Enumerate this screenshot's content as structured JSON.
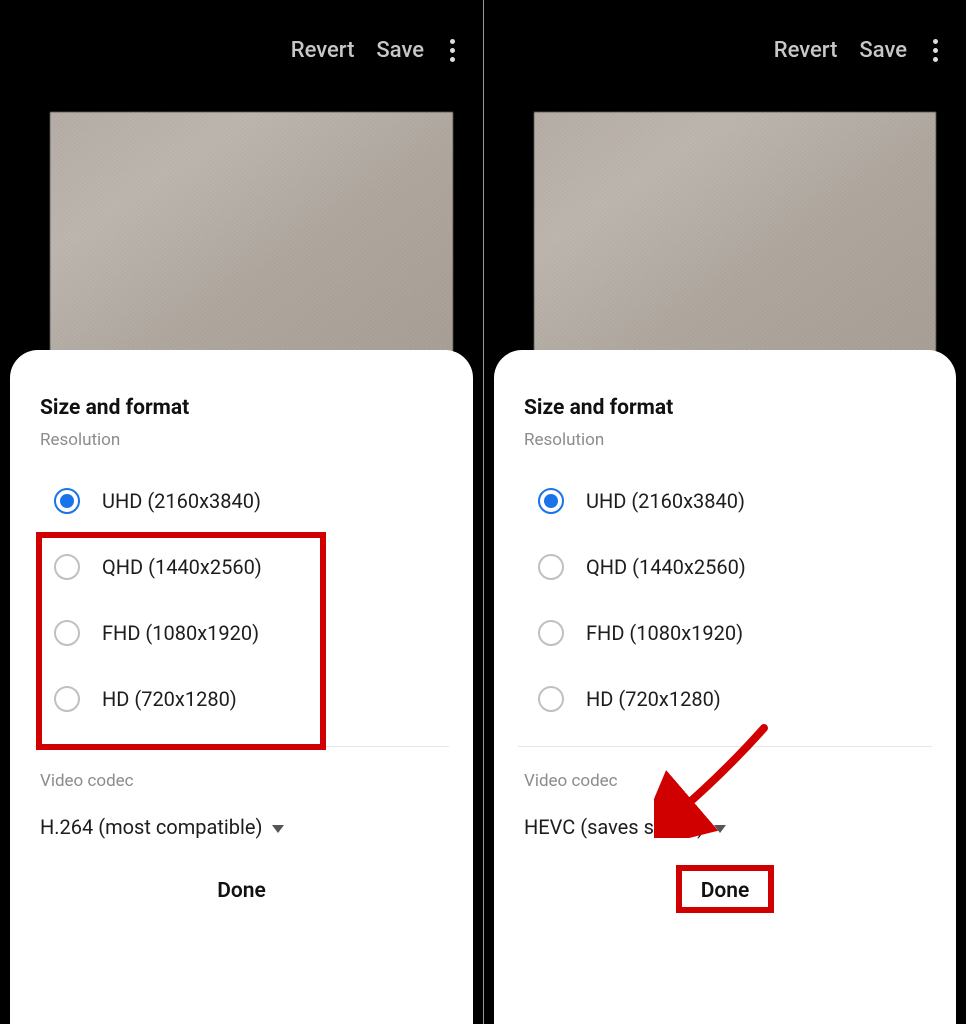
{
  "left": {
    "topbar": {
      "revert": "Revert",
      "save": "Save"
    },
    "sheet": {
      "title": "Size and format",
      "resolution_label": "Resolution",
      "options": [
        "UHD (2160x3840)",
        "QHD (1440x2560)",
        "FHD (1080x1920)",
        "HD (720x1280)"
      ],
      "codec_label": "Video codec",
      "codec_value": "H.264 (most compatible)",
      "done": "Done"
    }
  },
  "right": {
    "topbar": {
      "revert": "Revert",
      "save": "Save"
    },
    "sheet": {
      "title": "Size and format",
      "resolution_label": "Resolution",
      "options": [
        "UHD (2160x3840)",
        "QHD (1440x2560)",
        "FHD (1080x1920)",
        "HD (720x1280)"
      ],
      "codec_label": "Video codec",
      "codec_value": "HEVC (saves space)",
      "done": "Done"
    }
  }
}
